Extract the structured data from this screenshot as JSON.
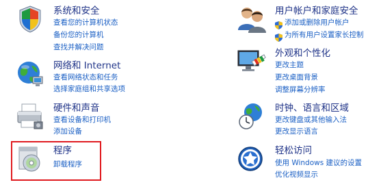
{
  "categories": [
    {
      "title": "系统和安全",
      "icon": "shield-flag-icon",
      "links": [
        "查看您的计算机状态",
        "备份您的计算机",
        "查找并解决问题"
      ]
    },
    {
      "title": "网络和 Internet",
      "icon": "network-globe-icon",
      "links": [
        "查看网络状态和任务",
        "选择家庭组和共享选项"
      ]
    },
    {
      "title": "硬件和声音",
      "icon": "printer-icon",
      "links": [
        "查看设备和打印机",
        "添加设备"
      ]
    },
    {
      "title": "程序",
      "icon": "programs-disc-icon",
      "links": [
        "卸载程序"
      ]
    },
    {
      "title": "用户帐户和家庭安全",
      "icon": "users-icon",
      "links": [
        "添加或删除用户帐户",
        "为所有用户设置家长控制"
      ]
    },
    {
      "title": "外观和个性化",
      "icon": "monitor-palette-icon",
      "links": [
        "更改主题",
        "更改桌面背景",
        "调整屏幕分辨率"
      ]
    },
    {
      "title": "时钟、语言和区域",
      "icon": "clock-globe-icon",
      "links": [
        "更改键盘或其他输入法",
        "更改显示语言"
      ]
    },
    {
      "title": "轻松访问",
      "icon": "ease-of-access-icon",
      "links": [
        "使用 Windows 建议的设置",
        "优化视频显示"
      ]
    }
  ],
  "colors": {
    "title": "#1e3287",
    "link": "#1a5fc4",
    "highlight": "#e0191e"
  }
}
